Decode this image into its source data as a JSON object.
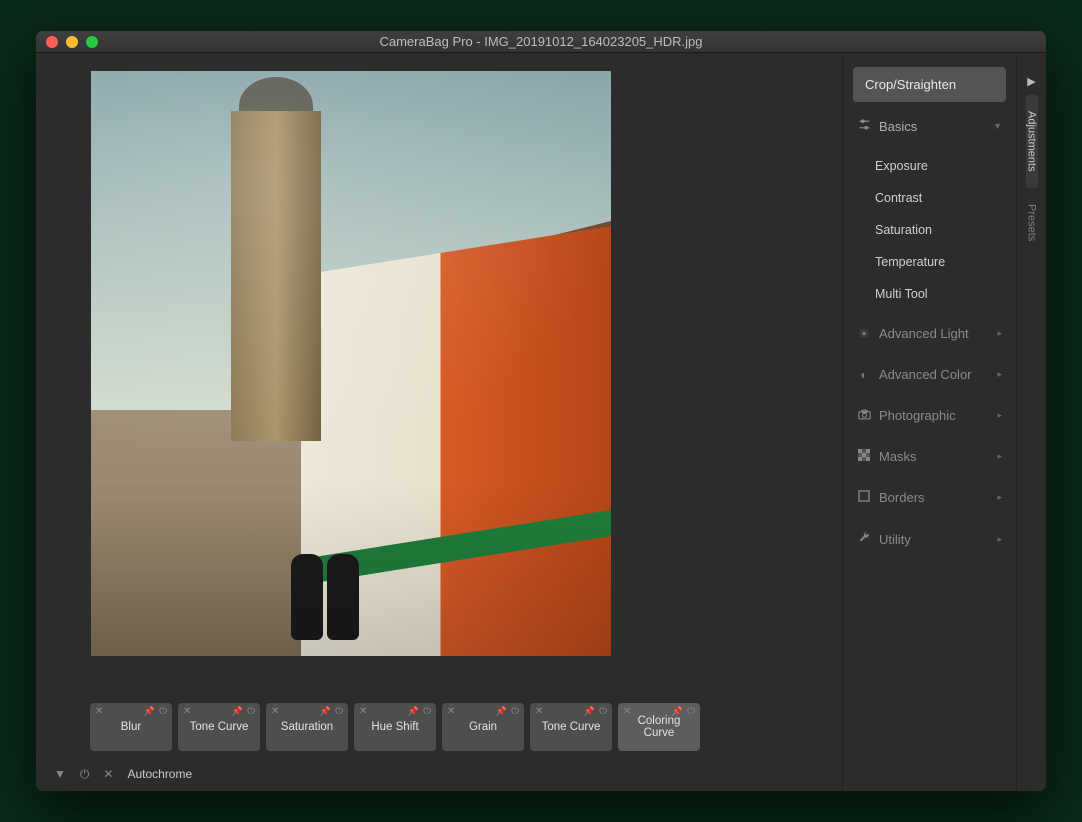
{
  "window": {
    "title": "CameraBag Pro - IMG_20191012_164023205_HDR.jpg"
  },
  "chips": [
    {
      "label": "Blur"
    },
    {
      "label": "Tone Curve"
    },
    {
      "label": "Saturation"
    },
    {
      "label": "Hue Shift"
    },
    {
      "label": "Grain"
    },
    {
      "label": "Tone Curve"
    },
    {
      "label": "Coloring Curve",
      "active": true
    }
  ],
  "preset_name": "Autochrome",
  "sidebar": {
    "crop_label": "Crop/Straighten",
    "sections": {
      "basics": {
        "label": "Basics",
        "items": [
          "Exposure",
          "Contrast",
          "Saturation",
          "Temperature",
          "Multi Tool"
        ]
      },
      "adv_light": "Advanced Light",
      "adv_color": "Advanced Color",
      "photographic": "Photographic",
      "masks": "Masks",
      "borders": "Borders",
      "utility": "Utility"
    }
  },
  "rail": {
    "adjustments": "Adjustments",
    "presets": "Presets"
  }
}
